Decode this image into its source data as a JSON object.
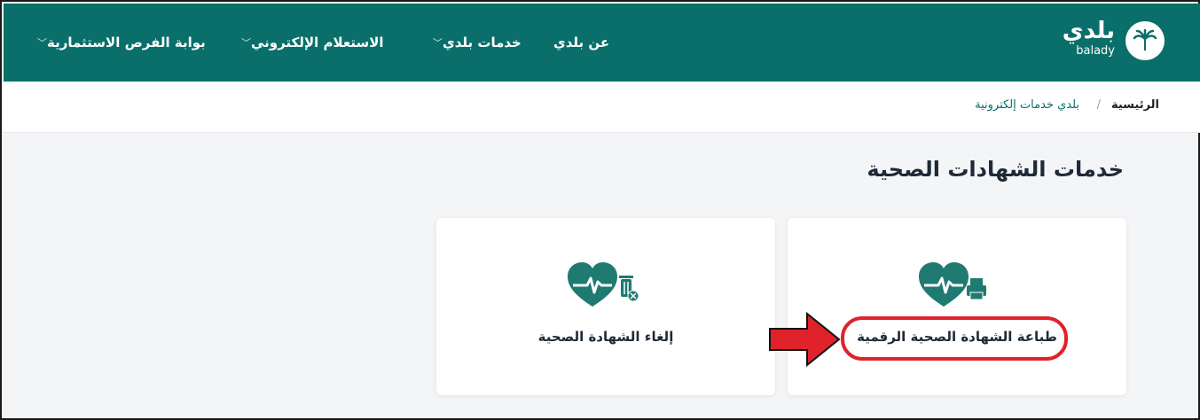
{
  "header": {
    "logo": {
      "ar": "بلدي",
      "en": "balady"
    },
    "nav": [
      {
        "label": "عن بلدي",
        "has_dropdown": false
      },
      {
        "label": "خدمات بلدي",
        "has_dropdown": true
      },
      {
        "label": "الاستعلام الإلكتروني",
        "has_dropdown": true
      },
      {
        "label": "بوابة الفرص الاستثمارية",
        "has_dropdown": true
      }
    ]
  },
  "breadcrumb": {
    "home": "الرئيسية",
    "separator": "/",
    "current": "بلدي خدمات إلكترونية"
  },
  "page": {
    "title": "خدمات الشهادات الصحية"
  },
  "cards": [
    {
      "label": "طباعة الشهادة الصحية الرقمية",
      "icon": "heart-printer-icon"
    },
    {
      "label": "إلغاء الشهادة الصحية",
      "icon": "heart-trash-icon"
    }
  ],
  "colors": {
    "brand": "#0a6f6a",
    "highlight": "#e0222a"
  }
}
